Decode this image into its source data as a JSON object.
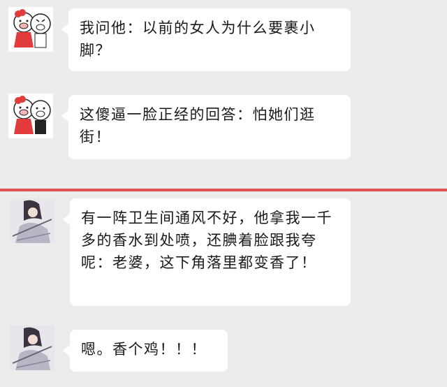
{
  "top_messages": [
    {
      "avatar_icon": "pig-couple-avatar",
      "text": "我问他：以前的女人为什么要裹小脚？"
    },
    {
      "avatar_icon": "pig-couple-avatar",
      "text": "这傻逼一脸正经的回答：怕她们逛街！"
    }
  ],
  "bottom_messages": [
    {
      "avatar_icon": "anime-girl-avatar",
      "text": "有一阵卫生间通风不好，他拿我一千多的香水到处喷，还腆着脸跟我夸呢：老婆，这下角落里都变香了！"
    },
    {
      "avatar_icon": "anime-girl-avatar",
      "text": "嗯。香个鸡！！！"
    }
  ],
  "colors": {
    "divider": "#e35454",
    "background": "#ececec",
    "bubble": "#ffffff"
  }
}
